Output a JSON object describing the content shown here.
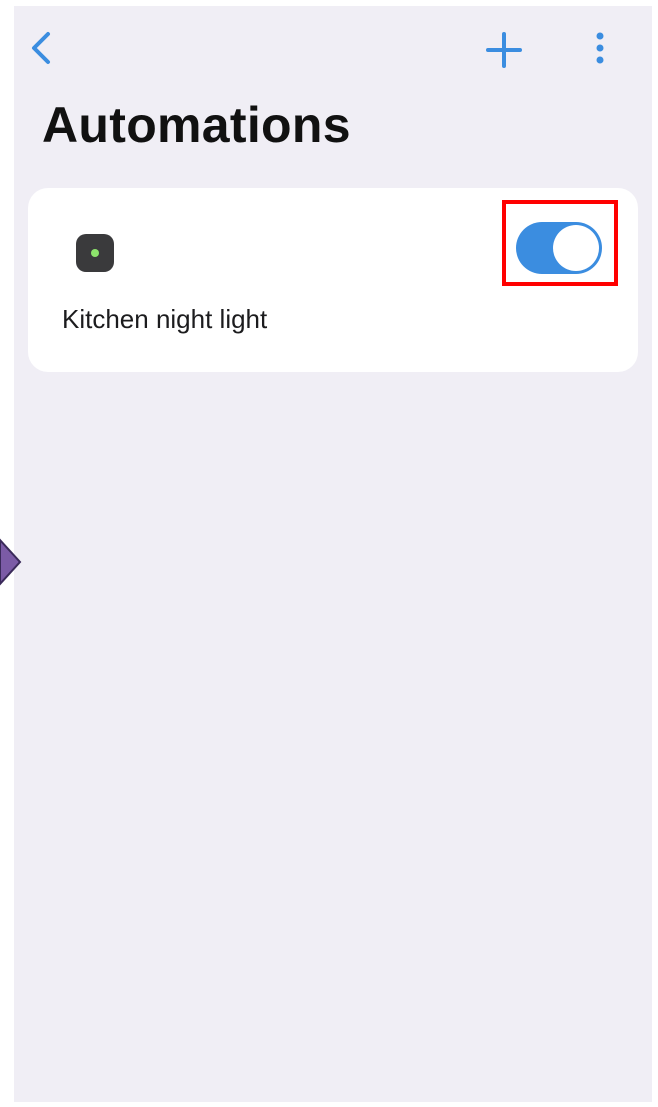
{
  "header": {
    "title": "Automations",
    "back_icon": "chevron-left-icon",
    "add_icon": "plus-icon",
    "more_icon": "more-vertical-icon"
  },
  "automations": [
    {
      "name": "Kitchen night light",
      "icon": "device-icon",
      "enabled": true
    }
  ],
  "colors": {
    "accent": "#3b8de0",
    "background": "#f0eef5",
    "card": "#ffffff",
    "highlight": "#ff0000",
    "device_icon": "#3a3a3c",
    "device_dot": "#8de36c"
  }
}
